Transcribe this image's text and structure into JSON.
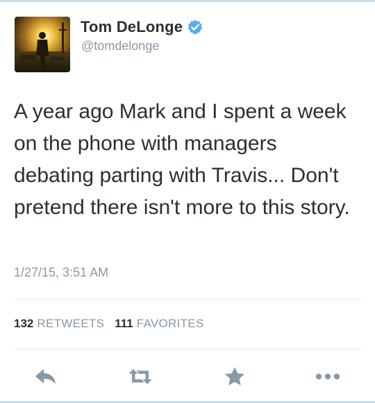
{
  "user": {
    "name": "Tom DeLonge",
    "handle": "@tomdelonge",
    "verified": true
  },
  "tweet": {
    "text": "A year ago Mark and I spent a week on the phone with managers debating parting with Travis... Don't pretend there isn't more to this story.",
    "timestamp": "1/27/15, 3:51 AM"
  },
  "stats": {
    "retweets_count": "132",
    "retweets_label": "RETWEETS",
    "favorites_count": "111",
    "favorites_label": "FAVORITES"
  },
  "actions": [
    {
      "icon": "reply-icon"
    },
    {
      "icon": "retweet-icon"
    },
    {
      "icon": "star-icon"
    },
    {
      "icon": "more-icon"
    }
  ],
  "colors": {
    "text": "#292f33",
    "muted": "#8899a6",
    "icon": "#8899a6",
    "verified": "#55acee",
    "divider": "#e1e8ed"
  }
}
